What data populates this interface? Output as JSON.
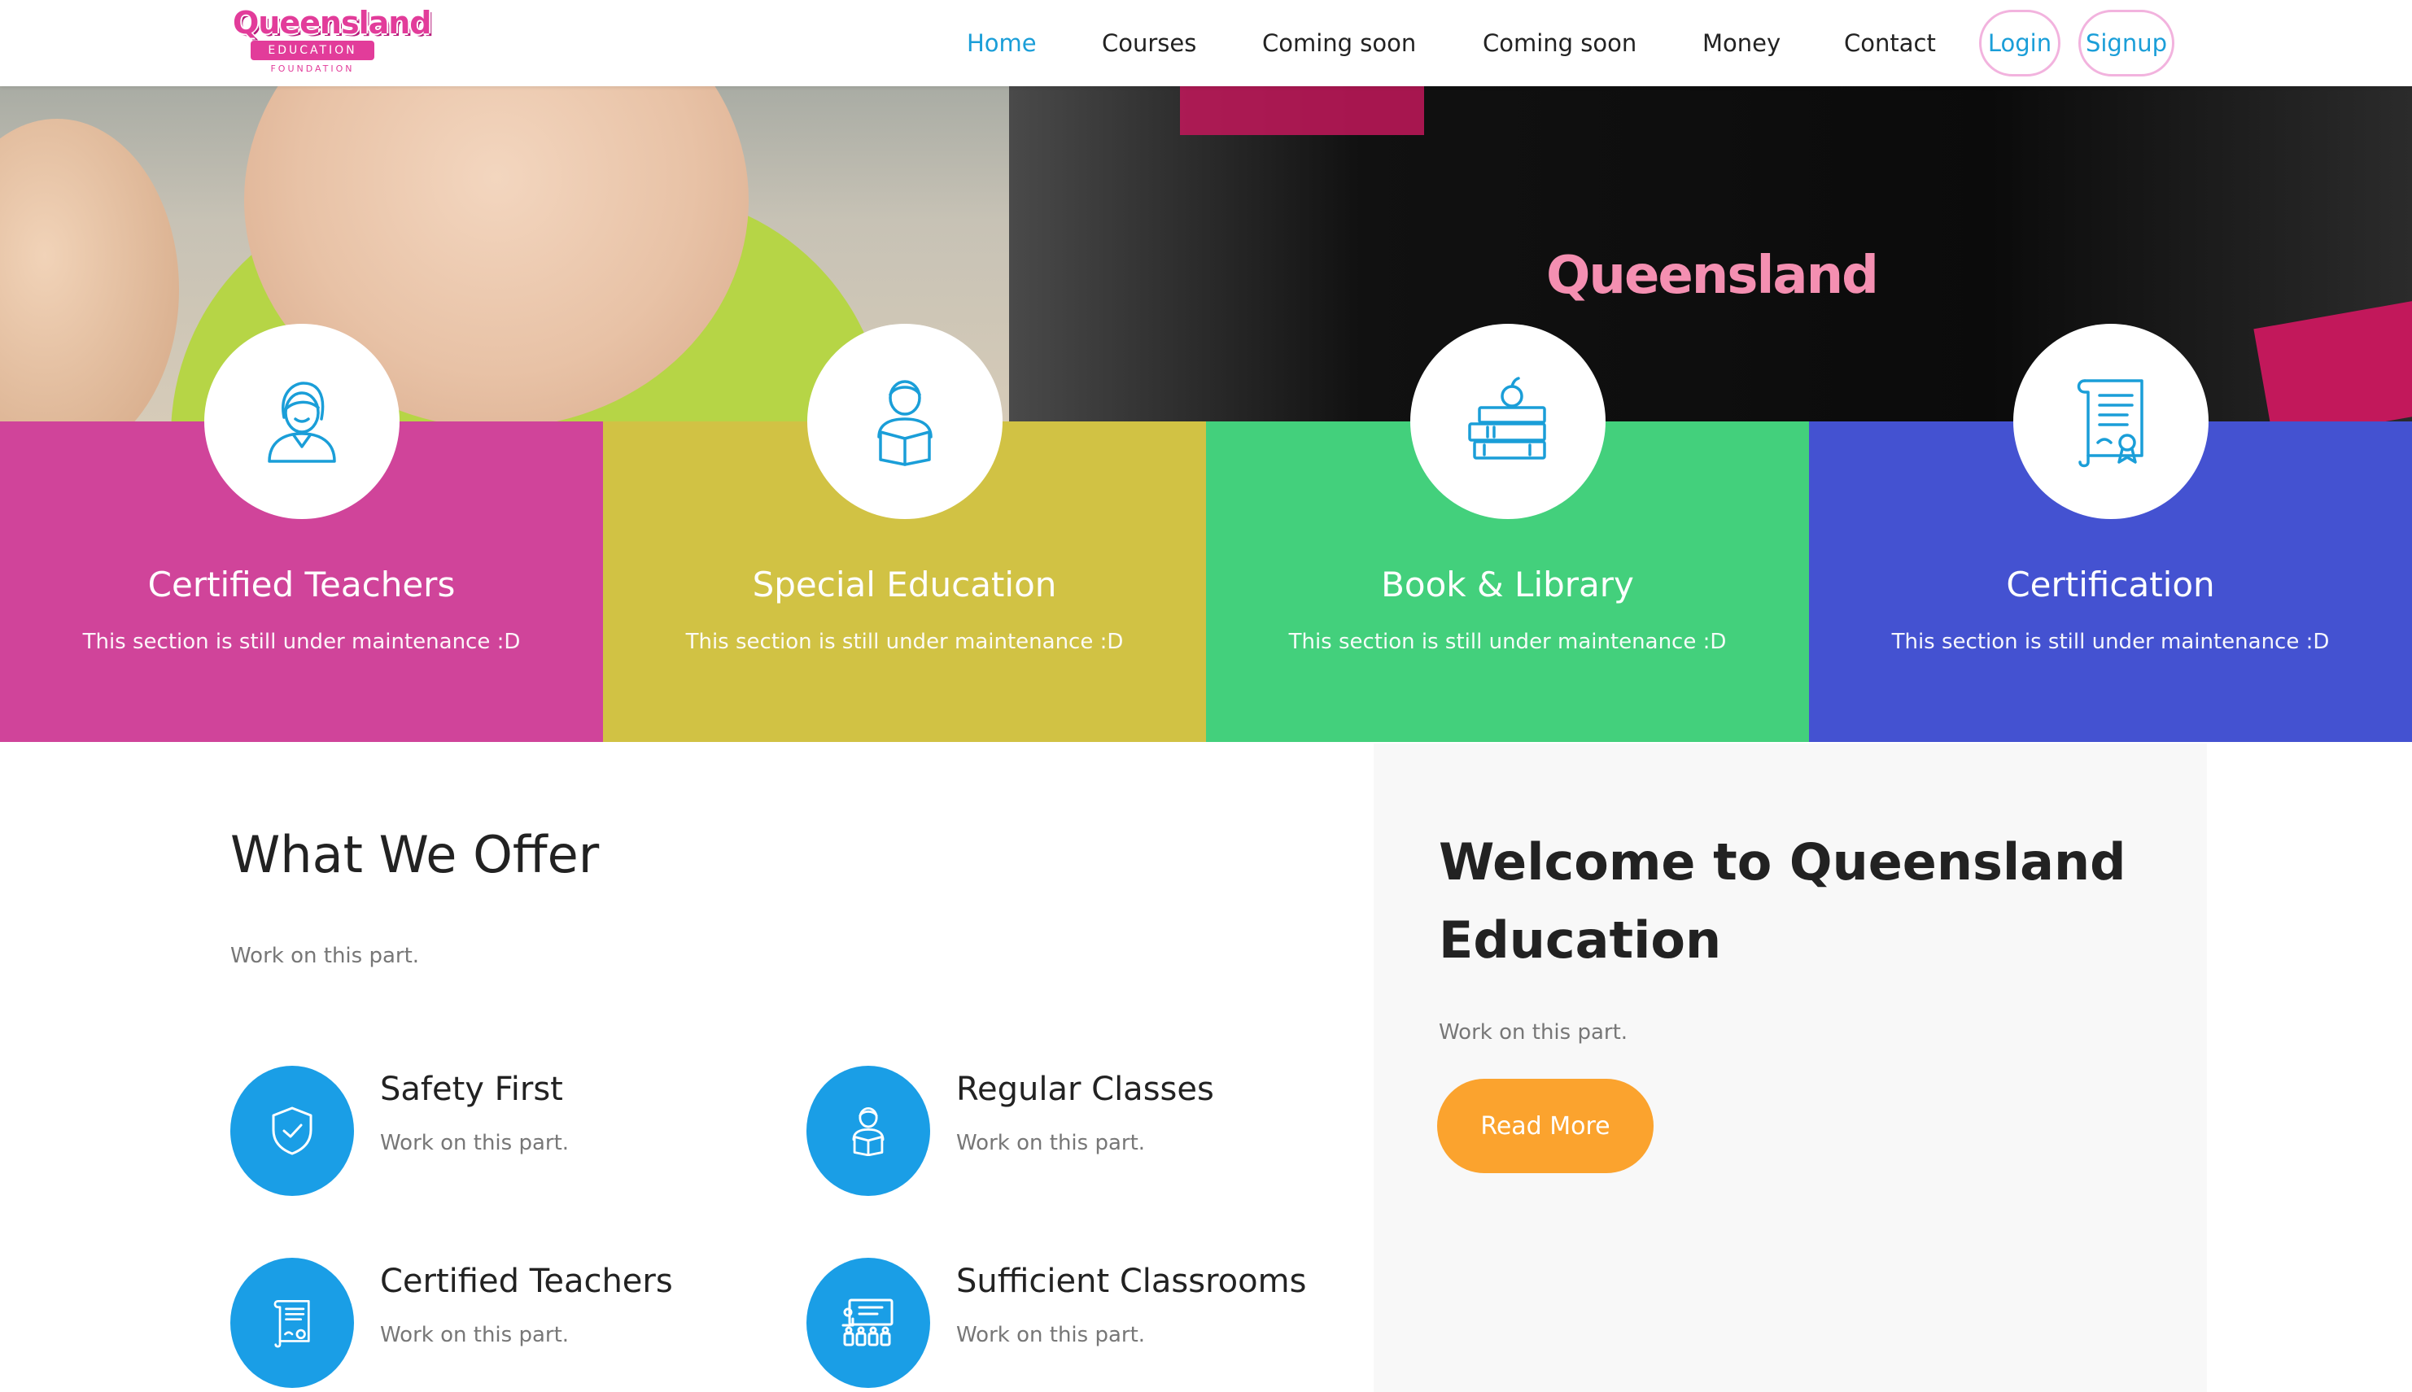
{
  "brand": {
    "logo_text": "Queensland",
    "logo_ribbon": "EDUCATION",
    "logo_sub": "FOUNDATION",
    "accent": "#1a9ed8",
    "pink": "#e23c9a"
  },
  "nav": {
    "items": [
      {
        "label": "Home",
        "active": true
      },
      {
        "label": "Courses",
        "active": false
      },
      {
        "label": "Coming soon",
        "active": false
      },
      {
        "label": "Coming soon",
        "active": false
      },
      {
        "label": "Money",
        "active": false
      },
      {
        "label": "Contact",
        "active": false
      }
    ],
    "login": "Login",
    "signup": "Signup"
  },
  "hero": {
    "shirt_text": "Queensland"
  },
  "features": [
    {
      "title": "Certified Teachers",
      "text": "This section is still under maintenance :D",
      "color": "#d0449a",
      "icon": "teacher-icon"
    },
    {
      "title": "Special Education",
      "text": "This section is still under maintenance :D",
      "color": "#d1c244",
      "icon": "student-reading-icon"
    },
    {
      "title": "Book & Library",
      "text": "This section is still under maintenance :D",
      "color": "#43d07c",
      "icon": "books-apple-icon"
    },
    {
      "title": "Certification",
      "text": "This section is still under maintenance :D",
      "color": "#4452d1",
      "icon": "certificate-scroll-icon"
    }
  ],
  "offer": {
    "title": "What We Offer",
    "subtitle": "Work on this part.",
    "services": [
      {
        "title": "Safety First",
        "text": "Work on this part.",
        "icon": "shield-check-icon"
      },
      {
        "title": "Regular Classes",
        "text": "Work on this part.",
        "icon": "student-reading-icon"
      },
      {
        "title": "Certified Teachers",
        "text": "Work on this part.",
        "icon": "certificate-scroll-icon"
      },
      {
        "title": "Sufficient Classrooms",
        "text": "Work on this part.",
        "icon": "classroom-icon"
      }
    ],
    "icon_color": "#1a9ee6"
  },
  "welcome": {
    "title": "Welcome to Queensland Education",
    "subtitle": "Work on this part.",
    "button": "Read More",
    "button_color": "#fba32e"
  }
}
